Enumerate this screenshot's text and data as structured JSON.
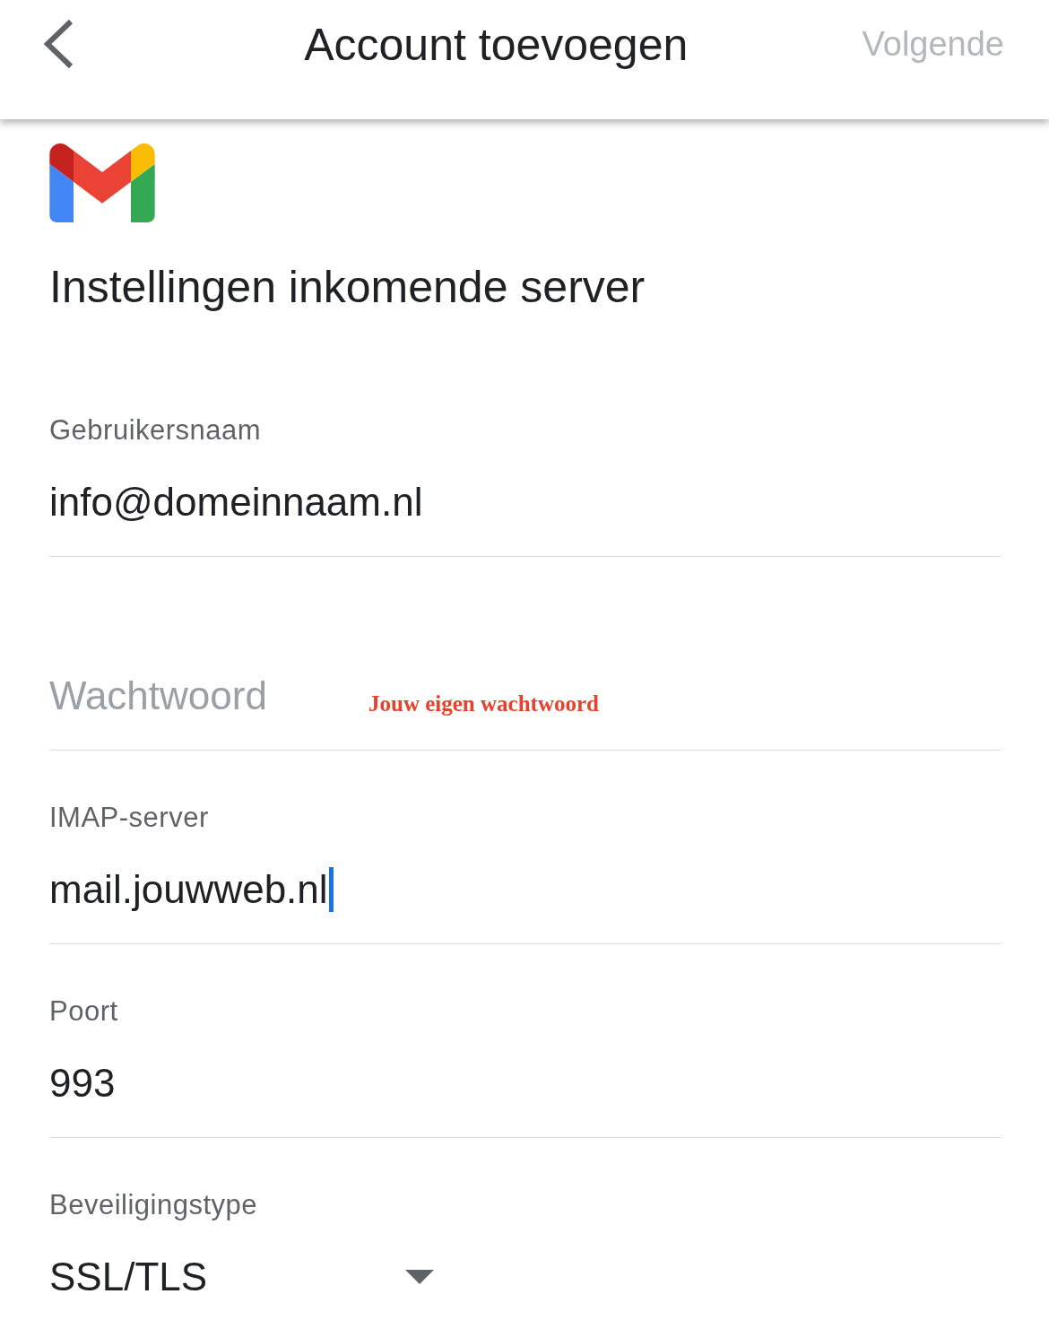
{
  "header": {
    "title": "Account toevoegen",
    "next_button": {
      "label": "Volgende",
      "disabled": true
    }
  },
  "heading": "Instellingen inkomende server",
  "fields": [
    {
      "kind": "text",
      "label": "Gebruikersnaam",
      "value": "info@domeinnaam.nl",
      "focused": false
    },
    {
      "kind": "password",
      "placeholder": "Wachtwoord",
      "annotation": "Jouw eigen wachtwoord",
      "focused": false
    },
    {
      "kind": "text",
      "label": "IMAP-server",
      "value": "mail.jouwweb.nl",
      "focused": true
    },
    {
      "kind": "text",
      "label": "Poort",
      "value": "993",
      "focused": false
    },
    {
      "kind": "select",
      "label": "Beveiligingstype",
      "value": "SSL/TLS",
      "focused": false
    }
  ]
}
